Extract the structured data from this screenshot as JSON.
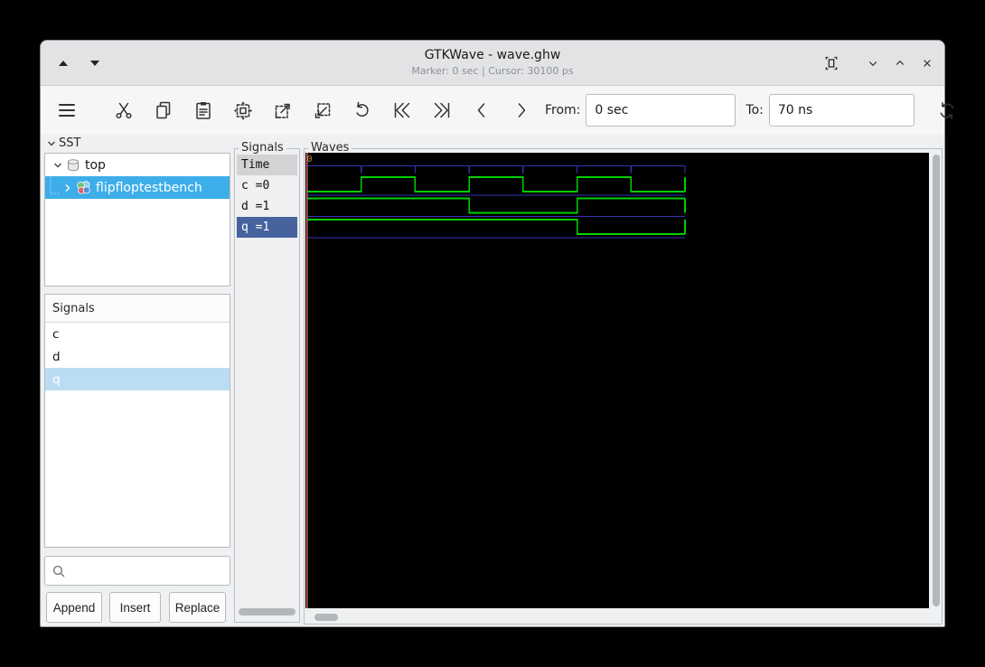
{
  "titlebar": {
    "title": "GTKWave - wave.ghw",
    "subtitle": "Marker: 0 sec  |  Cursor: 30100 ps"
  },
  "toolbar": {
    "from_label": "From:",
    "from_value": "0 sec",
    "to_label": "To:",
    "to_value": "70 ns"
  },
  "sst": {
    "label": "SST",
    "items": [
      {
        "label": "top"
      },
      {
        "label": "flipfloptestbench"
      }
    ]
  },
  "signal_search": {
    "header": "Signals",
    "items": [
      {
        "label": "c"
      },
      {
        "label": "d"
      },
      {
        "label": "q"
      }
    ],
    "buttons": {
      "append": "Append",
      "insert": "Insert",
      "replace": "Replace"
    }
  },
  "signals_panel": {
    "title": "Signals",
    "rows": [
      {
        "label": "Time"
      },
      {
        "label": "c =0"
      },
      {
        "label": "d =1"
      },
      {
        "label": "q =1"
      }
    ]
  },
  "waves": {
    "title": "Waves",
    "origin_label": "0"
  },
  "chart_data": {
    "type": "digital-waveform",
    "title": "Waves",
    "time_unit": "ns",
    "time_start": 0,
    "time_end": 70,
    "tick_interval": 10,
    "marker_time": 0,
    "signals": [
      {
        "name": "c",
        "value_at_marker": 0,
        "initial": 0,
        "toggle_times": [
          10,
          20,
          30,
          40,
          50,
          60
        ]
      },
      {
        "name": "d",
        "value_at_marker": 1,
        "initial": 1,
        "toggle_times": [
          30,
          50
        ]
      },
      {
        "name": "q",
        "value_at_marker": 1,
        "initial": 1,
        "toggle_times": [
          50
        ]
      }
    ],
    "colors": {
      "trace": "#00d000",
      "grid": "#3434b4",
      "marker": "#d25f5f",
      "time_label": "#b49a4a",
      "background": "#000000",
      "selection": "#3daee9"
    }
  }
}
